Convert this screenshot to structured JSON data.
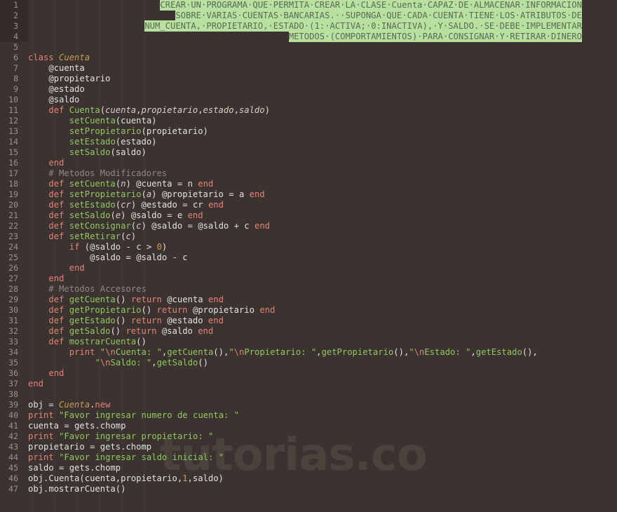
{
  "editor": {
    "app": "code-editor",
    "language": "ruby",
    "theme_background": "#3a332f",
    "gutter_text_color": "#9b938d",
    "selection_highlight_color": "#b8e0a0",
    "watermark": "tutorias.co",
    "first_line": 1,
    "last_line": 47
  },
  "prompt": {
    "selected": true,
    "lines": [
      "CREAR·UN·PROGRAMA·QUE·PERMITA·CREAR·LA·CLASE·Cuenta·CAPAZ·DE·ALMACENAR·INFORMACION",
      "SOBRE·VARIAS·CUENTAS·BANCARIAS.··SUPONGA·QUE·CADA·CUENTA·TIENE·LOS·ATRIBUTOS·DE",
      "NUM_CUENTA,·PROPIETARIO,·ESTADO·(1:·ACTIVA;·0:INACTIVA),·Y·SALDO.·SE·DEBE·IMPLEMENTAR",
      "METODOS·(COMPORTAMIENTOS)·PARA·CONSIGNAR·Y·RETIRAR·DINERO"
    ]
  },
  "code": {
    "lines": [
      {
        "n": 1,
        "type": "prompt",
        "text": "CREAR·UN·PROGRAMA·QUE·PERMITA·CREAR·LA·CLASE·Cuenta·CAPAZ·DE·ALMACENAR·INFORMACION"
      },
      {
        "n": 2,
        "type": "prompt",
        "text": "SOBRE·VARIAS·CUENTAS·BANCARIAS.··SUPONGA·QUE·CADA·CUENTA·TIENE·LOS·ATRIBUTOS·DE"
      },
      {
        "n": 3,
        "type": "prompt",
        "text": "NUM_CUENTA,·PROPIETARIO,·ESTADO·(1:·ACTIVA;·0:INACTIVA),·Y·SALDO.·SE·DEBE·IMPLEMENTAR"
      },
      {
        "n": 4,
        "type": "prompt",
        "text": "METODOS·(COMPORTAMIENTOS)·PARA·CONSIGNAR·Y·RETIRAR·DINERO"
      },
      {
        "n": 5,
        "type": "code",
        "text": ""
      },
      {
        "n": 6,
        "type": "code",
        "text": "class Cuenta"
      },
      {
        "n": 7,
        "type": "code",
        "text": "    @cuenta"
      },
      {
        "n": 8,
        "type": "code",
        "text": "    @propietario"
      },
      {
        "n": 9,
        "type": "code",
        "text": "    @estado"
      },
      {
        "n": 10,
        "type": "code",
        "text": "    @saldo"
      },
      {
        "n": 11,
        "type": "code",
        "text": "    def Cuenta(cuenta,propietario,estado,saldo)"
      },
      {
        "n": 12,
        "type": "code",
        "text": "        setCuenta(cuenta)"
      },
      {
        "n": 13,
        "type": "code",
        "text": "        setPropietario(propietario)"
      },
      {
        "n": 14,
        "type": "code",
        "text": "        setEstado(estado)"
      },
      {
        "n": 15,
        "type": "code",
        "text": "        setSaldo(saldo)"
      },
      {
        "n": 16,
        "type": "code",
        "text": "    end"
      },
      {
        "n": 17,
        "type": "code",
        "text": "    # Metodos Modificadores"
      },
      {
        "n": 18,
        "type": "code",
        "text": "    def setCuenta(n) @cuenta = n end"
      },
      {
        "n": 19,
        "type": "code",
        "text": "    def setPropietario(a) @propietario = a end"
      },
      {
        "n": 20,
        "type": "code",
        "text": "    def setEstado(cr) @estado = cr end"
      },
      {
        "n": 21,
        "type": "code",
        "text": "    def setSaldo(e) @saldo = e end"
      },
      {
        "n": 22,
        "type": "code",
        "text": "    def setConsignar(c) @saldo = @saldo + c end"
      },
      {
        "n": 23,
        "type": "code",
        "text": "    def setRetirar(c)"
      },
      {
        "n": 24,
        "type": "code",
        "text": "        if (@saldo - c > 0)"
      },
      {
        "n": 25,
        "type": "code",
        "text": "            @saldo = @saldo - c"
      },
      {
        "n": 26,
        "type": "code",
        "text": "        end"
      },
      {
        "n": 27,
        "type": "code",
        "text": "    end"
      },
      {
        "n": 28,
        "type": "code",
        "text": "    # Metodos Accesores"
      },
      {
        "n": 29,
        "type": "code",
        "text": "    def getCuenta() return @cuenta end"
      },
      {
        "n": 30,
        "type": "code",
        "text": "    def getPropietario() return @propietario end"
      },
      {
        "n": 31,
        "type": "code",
        "text": "    def getEstado() return @estado end"
      },
      {
        "n": 32,
        "type": "code",
        "text": "    def getSaldo() return @saldo end"
      },
      {
        "n": 33,
        "type": "code",
        "text": "    def mostrarCuenta()"
      },
      {
        "n": 34,
        "type": "code",
        "text": "        print \"\\nCuenta: \",getCuenta(),\"\\nPropietario: \",getPropietario(),\"\\nEstado: \",getEstado(),"
      },
      {
        "n": 35,
        "type": "code",
        "text": "             \"\\nSaldo: \",getSaldo()"
      },
      {
        "n": 36,
        "type": "code",
        "text": "    end"
      },
      {
        "n": 37,
        "type": "code",
        "text": "end"
      },
      {
        "n": 38,
        "type": "code",
        "text": ""
      },
      {
        "n": 39,
        "type": "code",
        "text": "obj = Cuenta.new"
      },
      {
        "n": 40,
        "type": "code",
        "text": "print \"Favor ingresar numero de cuenta: \""
      },
      {
        "n": 41,
        "type": "code",
        "text": "cuenta = gets.chomp"
      },
      {
        "n": 42,
        "type": "code",
        "text": "print \"Favor ingresar propietario: \""
      },
      {
        "n": 43,
        "type": "code",
        "text": "propietario = gets.chomp"
      },
      {
        "n": 44,
        "type": "code",
        "text": "print \"Favor ingresar saldo inicial: \""
      },
      {
        "n": 45,
        "type": "code",
        "text": "saldo = gets.chomp"
      },
      {
        "n": 46,
        "type": "code",
        "text": "obj.Cuenta(cuenta,propietario,1,saldo)"
      },
      {
        "n": 47,
        "type": "code",
        "text": "obj.mostrarCuenta()"
      }
    ]
  }
}
